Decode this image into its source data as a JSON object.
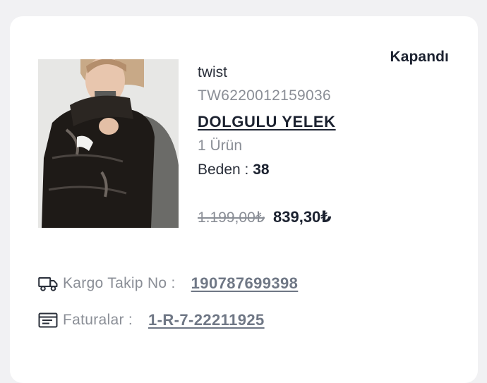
{
  "order": {
    "status": "Kapandı",
    "item": {
      "brand": "twist",
      "sku": "TW6220012159036",
      "name": "DOLGULU YELEK",
      "quantity": "1 Ürün",
      "size_label": "Beden : ",
      "size_value": "38",
      "old_price": "1.199,00₺",
      "new_price": "839,30₺"
    },
    "cargo": {
      "icon": "truck-icon",
      "label": "Kargo Takip No :",
      "tracking_number": "190787699398"
    },
    "invoice": {
      "icon": "invoice-icon",
      "label": "Faturalar :",
      "number": "1-R-7-22211925"
    }
  },
  "colors": {
    "text_dark": "#1c2230",
    "text_muted": "#8a8e96",
    "link": "#6f7785",
    "card_bg": "#ffffff",
    "page_bg": "#f1f1f3"
  }
}
